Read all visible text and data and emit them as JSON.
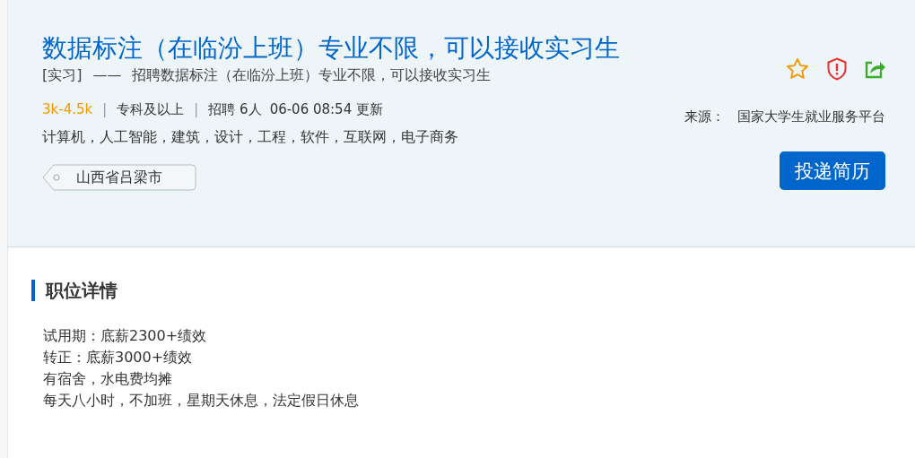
{
  "job": {
    "title": "数据标注（在临汾上班）专业不限，可以接收实习生",
    "type_tag": "[实习]",
    "dash": "——",
    "subtitle": "招聘数据标注（在临汾上班）专业不限，可以接收实习生",
    "salary": "3k-4.5k",
    "meta": [
      {
        "kind": "sep",
        "text": "|"
      },
      {
        "kind": "text",
        "text": "专科及以上"
      },
      {
        "kind": "sep",
        "text": "|"
      },
      {
        "kind": "text",
        "text": "招聘 6人"
      },
      {
        "kind": "text",
        "text": "06-06 08:54 更新"
      }
    ],
    "majors": "计算机，人工智能，建筑，设计，工程，软件，互联网，电子商务",
    "location": "山西省吕梁市",
    "source_label": "来源：",
    "source": "国家大学生就业服务平台",
    "apply_button": "投递简历"
  },
  "details": {
    "heading": "职位详情",
    "lines": [
      "试用期：底薪2300+绩效",
      "转正：底薪3000+绩效",
      "有宿舍，水电费均摊",
      "每天八小时，不加班，星期天休息，法定假日休息"
    ]
  }
}
